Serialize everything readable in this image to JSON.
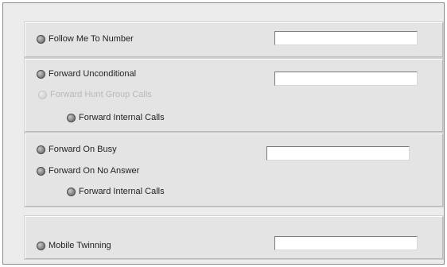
{
  "follow_me": {
    "label": "Follow Me To Number",
    "number_value": ""
  },
  "forward_unconditional": {
    "label": "Forward Unconditional",
    "number_value": "",
    "hunt_group_label": "Forward Hunt Group Calls",
    "internal_label": "Forward Internal Calls"
  },
  "forward_busy_no_answer": {
    "busy_label": "Forward On Busy",
    "no_answer_label": "Forward On No Answer",
    "internal_label": "Forward Internal Calls",
    "number_value": ""
  },
  "mobile_twinning": {
    "label": "Mobile Twinning",
    "number_value": ""
  }
}
